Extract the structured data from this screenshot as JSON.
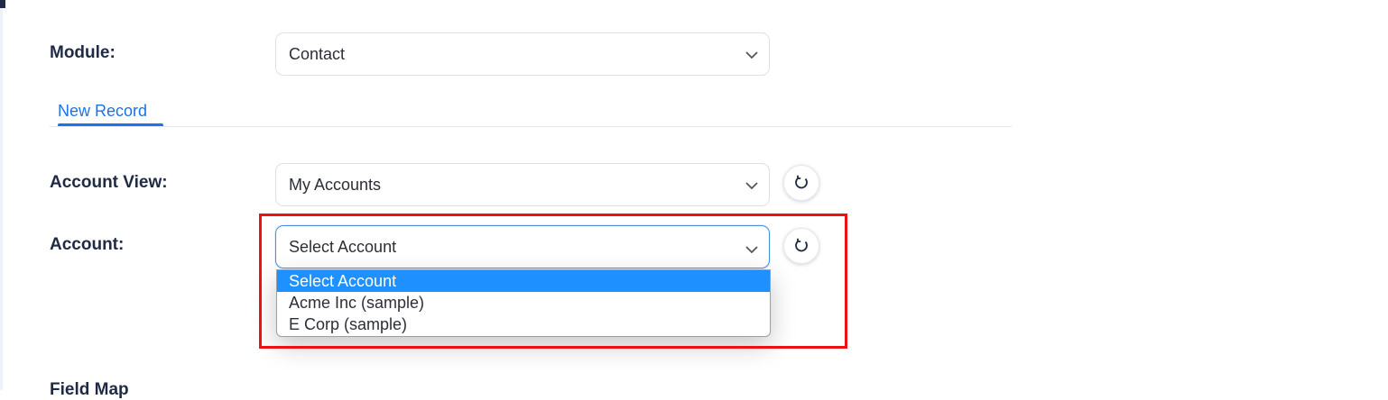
{
  "module": {
    "label": "Module:",
    "value": "Contact"
  },
  "tabs": [
    {
      "label": "New Record"
    }
  ],
  "account_view": {
    "label": "Account View:",
    "value": "My Accounts"
  },
  "account": {
    "label": "Account:",
    "value": "Select Account",
    "options": [
      {
        "label": "Select Account",
        "selected": true
      },
      {
        "label": "Acme Inc (sample)",
        "selected": false
      },
      {
        "label": "E Corp (sample)",
        "selected": false
      }
    ]
  },
  "field_map": {
    "label": "Field Map"
  },
  "colors": {
    "accent": "#1a73e8",
    "highlight": "#ee1111",
    "option_selected": "#1e90ff"
  },
  "icons": {
    "dropdown": "chevron-down-icon",
    "refresh": "refresh-icon"
  }
}
